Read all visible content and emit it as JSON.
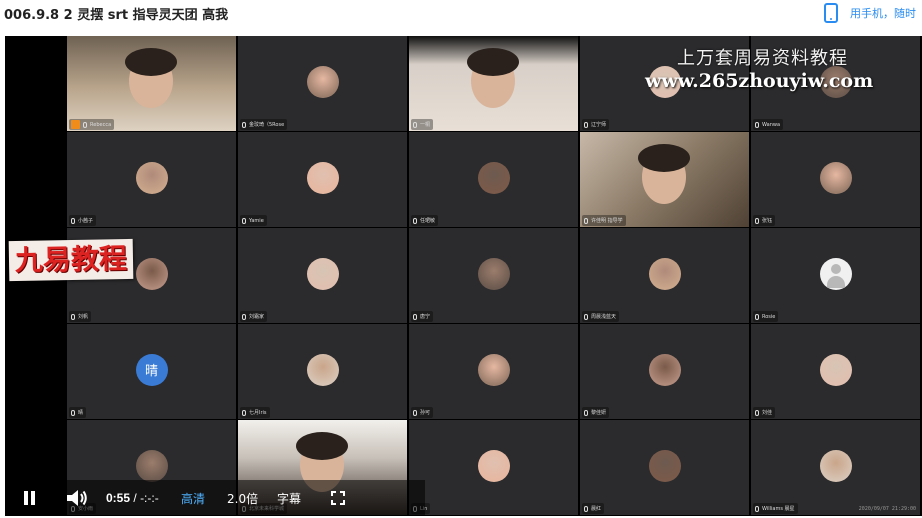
{
  "header": {
    "title": "006.9.8 2 灵摆 srt 指导灵天团 高我",
    "phone_link": "用手机，随时"
  },
  "watermarks": {
    "line1": "上万套周易资料教程",
    "line2": "www.265zhouyiw.com",
    "stamp": "九易教程"
  },
  "participants": [
    {
      "name": "Rebecca",
      "kind": "video",
      "style": "v1",
      "host": true
    },
    {
      "name": "金玟琦（5Rose",
      "kind": "avatar"
    },
    {
      "name": "一桐",
      "kind": "video",
      "style": "v2"
    },
    {
      "name": "辽宁师",
      "kind": "avatar"
    },
    {
      "name": "Wanwa",
      "kind": "avatar"
    },
    {
      "name": "小茜子",
      "kind": "avatar"
    },
    {
      "name": "Yamie",
      "kind": "avatar"
    },
    {
      "name": "任珺敏",
      "kind": "avatar"
    },
    {
      "name": "许佳明 指导学",
      "kind": "video",
      "style": "v3"
    },
    {
      "name": "张钰",
      "kind": "avatar"
    },
    {
      "name": "刘帆",
      "kind": "avatar"
    },
    {
      "name": "刘霜家",
      "kind": "avatar"
    },
    {
      "name": "唐宁",
      "kind": "avatar"
    },
    {
      "name": "周晨浅蓝天",
      "kind": "avatar"
    },
    {
      "name": "Rosie",
      "kind": "avatar",
      "default": true
    },
    {
      "name": "晴",
      "kind": "letter",
      "letter": "晴"
    },
    {
      "name": "七月Iris",
      "kind": "avatar"
    },
    {
      "name": "孙可",
      "kind": "avatar"
    },
    {
      "name": "黎佳妍",
      "kind": "avatar"
    },
    {
      "name": "刘佳",
      "kind": "avatar"
    },
    {
      "name": "安小雨",
      "kind": "avatar"
    },
    {
      "name": "北京未来科学城",
      "kind": "video",
      "style": "v4"
    },
    {
      "name": "Lin",
      "kind": "avatar"
    },
    {
      "name": "晨红",
      "kind": "avatar"
    },
    {
      "name": "Williams 晨星",
      "kind": "avatar"
    }
  ],
  "recording_timestamp": "2020/09/07 21:29:00",
  "player": {
    "current_time": "0:55",
    "separator": "/",
    "duration": "-:-:-",
    "quality": "高清",
    "speed": "2.0倍",
    "subtitle": "字幕"
  },
  "colors": {
    "link_blue": "#2a8cf0",
    "quality_blue": "#4fb3ff",
    "host_orange": "#f08c1a",
    "stamp_red": "#dd2222"
  }
}
